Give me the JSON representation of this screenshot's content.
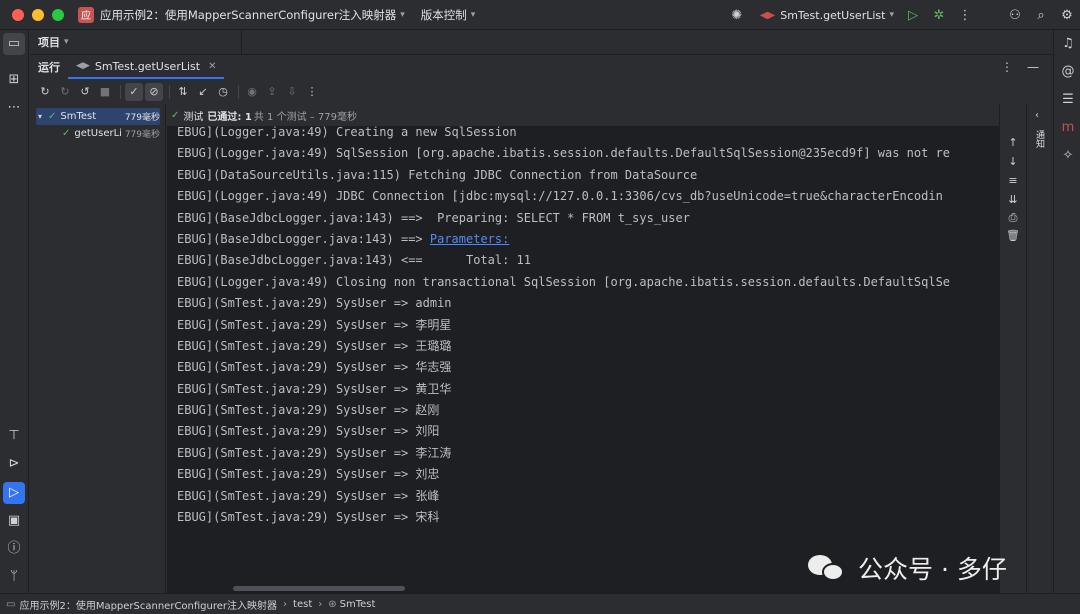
{
  "titlebar": {
    "project_badge": "应",
    "project_name": "应用示例2：使用MapperScannerConfigurer注入映射器",
    "vcs_label": "版本控制",
    "run_config": "SmTest.getUserList"
  },
  "project_bar": {
    "label": "项目"
  },
  "run_bar": {
    "label": "运行",
    "tab_label": "SmTest.getUserList"
  },
  "tree": {
    "items": [
      {
        "name": "SmTest",
        "duration": "779毫秒"
      },
      {
        "name": "getUserLi",
        "duration": "779毫秒"
      }
    ]
  },
  "status": {
    "prefix": "测试",
    "passed": "已通过: 1",
    "detail": "共 1 个测试 – 779毫秒"
  },
  "log": {
    "lines": [
      {
        "a": "EBUG](Logger.java:49) Creating a new SqlSession",
        "link": "",
        "b": ""
      },
      {
        "a": "EBUG](Logger.java:49) SqlSession [org.apache.ibatis.session.defaults.DefaultSqlSession@235ecd9f] was not re",
        "link": "",
        "b": ""
      },
      {
        "a": "EBUG](DataSourceUtils.java:115) Fetching JDBC Connection from DataSource",
        "link": "",
        "b": ""
      },
      {
        "a": "EBUG](Logger.java:49) JDBC Connection [jdbc:mysql://127.0.0.1:3306/cvs_db?useUnicode=true&characterEncodin",
        "link": "",
        "b": ""
      },
      {
        "a": "EBUG](BaseJdbcLogger.java:143) ==>  Preparing: SELECT * FROM t_sys_user",
        "link": "",
        "b": ""
      },
      {
        "a": "EBUG](BaseJdbcLogger.java:143) ==> ",
        "link": "Parameters:",
        "b": ""
      },
      {
        "a": "EBUG](BaseJdbcLogger.java:143) <==      Total: 11",
        "link": "",
        "b": ""
      },
      {
        "a": "EBUG](Logger.java:49) Closing non transactional SqlSession [org.apache.ibatis.session.defaults.DefaultSqlSe",
        "link": "",
        "b": ""
      },
      {
        "a": "EBUG](SmTest.java:29) SysUser => admin",
        "link": "",
        "b": ""
      },
      {
        "a": "EBUG](SmTest.java:29) SysUser => 李明星",
        "link": "",
        "b": ""
      },
      {
        "a": "EBUG](SmTest.java:29) SysUser => 王璐璐",
        "link": "",
        "b": ""
      },
      {
        "a": "EBUG](SmTest.java:29) SysUser => 华志强",
        "link": "",
        "b": ""
      },
      {
        "a": "EBUG](SmTest.java:29) SysUser => 黄卫华",
        "link": "",
        "b": ""
      },
      {
        "a": "EBUG](SmTest.java:29) SysUser => 赵刚",
        "link": "",
        "b": ""
      },
      {
        "a": "EBUG](SmTest.java:29) SysUser => 刘阳",
        "link": "",
        "b": ""
      },
      {
        "a": "EBUG](SmTest.java:29) SysUser => 李江涛",
        "link": "",
        "b": ""
      },
      {
        "a": "EBUG](SmTest.java:29) SysUser => 刘忠",
        "link": "",
        "b": ""
      },
      {
        "a": "EBUG](SmTest.java:29) SysUser => 张峰",
        "link": "",
        "b": ""
      },
      {
        "a": "EBUG](SmTest.java:29) SysUser => 宋科",
        "link": "",
        "b": ""
      }
    ]
  },
  "notifications_label": "通知",
  "footer": {
    "crumbs": [
      "应用示例2：使用MapperScannerConfigurer注入映射器",
      "test",
      "SmTest"
    ]
  },
  "watermark": {
    "text": "公众号 · 多仔"
  },
  "colors": {
    "accent": "#3574f0",
    "pass": "#5fb865",
    "link": "#548af7"
  }
}
